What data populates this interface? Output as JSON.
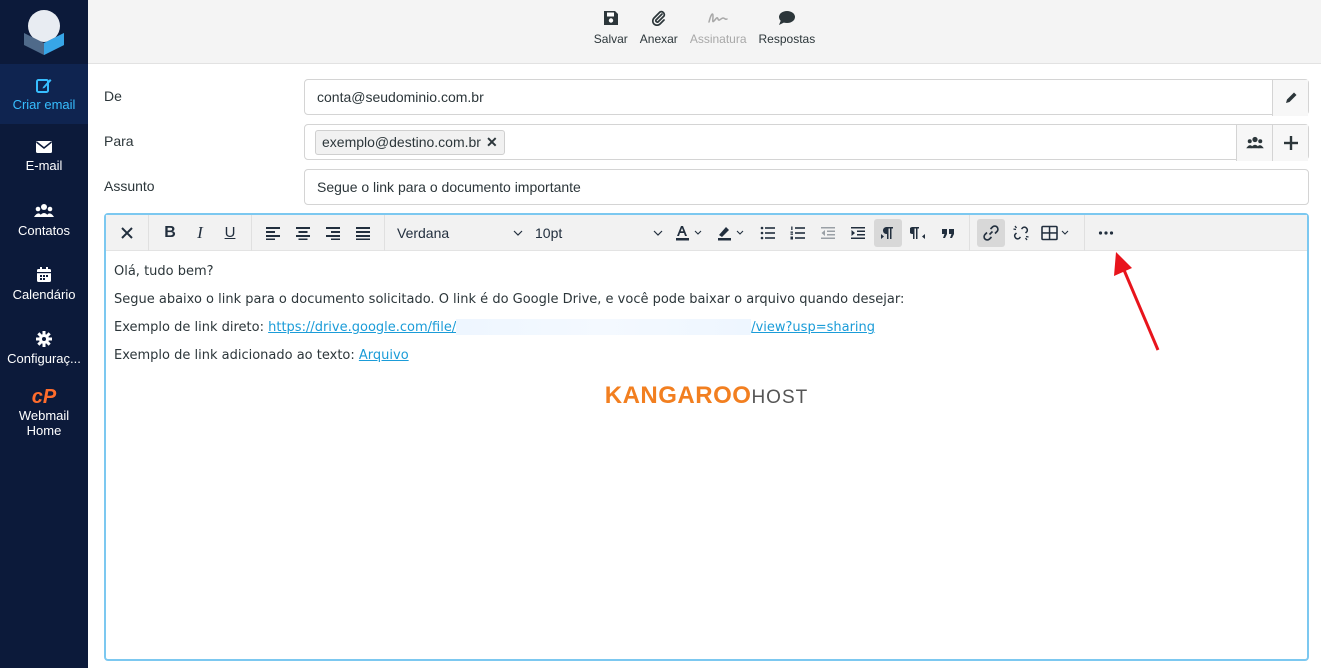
{
  "sidebar": {
    "items": [
      {
        "label": "Criar email",
        "icon": "compose-icon",
        "active": true
      },
      {
        "label": "E-mail",
        "icon": "envelope-icon"
      },
      {
        "label": "Contatos",
        "icon": "contacts-icon"
      },
      {
        "label": "Calendário",
        "icon": "calendar-icon"
      },
      {
        "label": "Configuraç...",
        "icon": "gear-icon"
      },
      {
        "label": "Webmail",
        "label2": "Home",
        "icon": "cpanel-icon",
        "icon_text": "cP"
      }
    ]
  },
  "toolbar": {
    "save": "Salvar",
    "attach": "Anexar",
    "signature": "Assinatura",
    "responses": "Respostas"
  },
  "compose": {
    "from_label": "De",
    "from_value": "conta@seudominio.com.br",
    "to_label": "Para",
    "to_recipient": "exemplo@destino.com.br",
    "subject_label": "Assunto",
    "subject_value": "Segue o link para o documento importante"
  },
  "editor": {
    "font_family": "Verdana",
    "font_size": "10pt",
    "body": {
      "line1": "Olá, tudo bem?",
      "line2": "Segue abaixo o link para o documento solicitado. O link é do Google Drive, e você pode baixar o arquivo quando desejar:",
      "line3_prefix": "Exemplo de link direto: ",
      "line3_link_start": "https://drive.google.com/file/",
      "line3_link_end": "/view?usp=sharing",
      "line4_prefix": "Exemplo de link adicionado ao texto: ",
      "line4_link": "Arquivo",
      "brand_main": "KANGAROO",
      "brand_sub": "HOST"
    }
  },
  "colors": {
    "sidebar_bg": "#0c1a3a",
    "accent": "#37beff",
    "link": "#1b9cd8",
    "brand_orange": "#f27f20",
    "annotation_arrow": "#e8141c"
  }
}
